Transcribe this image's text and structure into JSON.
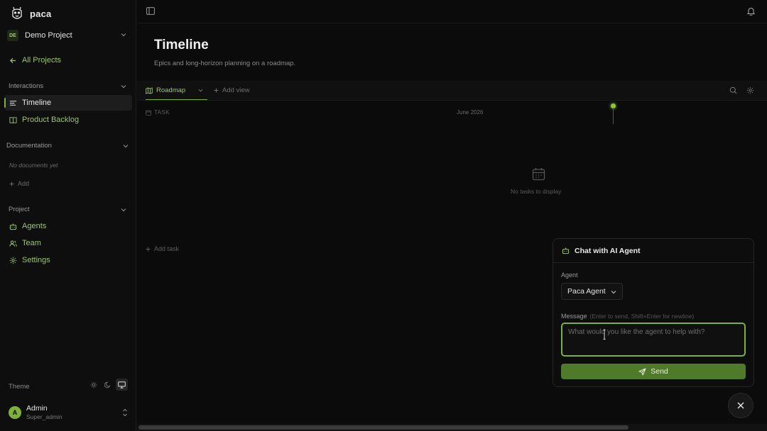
{
  "app": {
    "name": "paca"
  },
  "project": {
    "badge": "DE",
    "name": "Demo Project"
  },
  "nav": {
    "all_projects": "All Projects"
  },
  "sections": {
    "interactions": {
      "title": "Interactions",
      "items": [
        {
          "label": "Timeline",
          "icon": "list-icon",
          "active": true
        },
        {
          "label": "Product Backlog",
          "icon": "book-icon"
        }
      ]
    },
    "documentation": {
      "title": "Documentation",
      "empty": "No documents yet",
      "add": "Add"
    },
    "project": {
      "title": "Project",
      "items": [
        {
          "label": "Agents",
          "icon": "bot-icon"
        },
        {
          "label": "Team",
          "icon": "users-icon"
        },
        {
          "label": "Settings",
          "icon": "gear-icon"
        }
      ]
    }
  },
  "theme": {
    "label": "Theme",
    "options": [
      "light",
      "dark",
      "system"
    ],
    "selected": "system"
  },
  "user": {
    "initial": "A",
    "name": "Admin",
    "role": "Super_admin"
  },
  "page": {
    "title": "Timeline",
    "subtitle": "Epics and long-horizon planning on a roadmap."
  },
  "views": {
    "active": "Roadmap",
    "add": "Add view"
  },
  "timeline": {
    "task_col": "TASK",
    "month": "June 2026",
    "empty": "No tasks to display",
    "add_task": "Add task"
  },
  "chat": {
    "title": "Chat with AI Agent",
    "agent_label": "Agent",
    "agent_value": "Paca Agent",
    "message_label": "Message",
    "message_hint": "(Enter to send, Shift+Enter for newline)",
    "placeholder": "What would you like the agent to help with?",
    "send": "Send"
  },
  "colors": {
    "accent": "#7fb03a",
    "accent_text": "#9bc66a",
    "background": "#0b0b0b"
  }
}
